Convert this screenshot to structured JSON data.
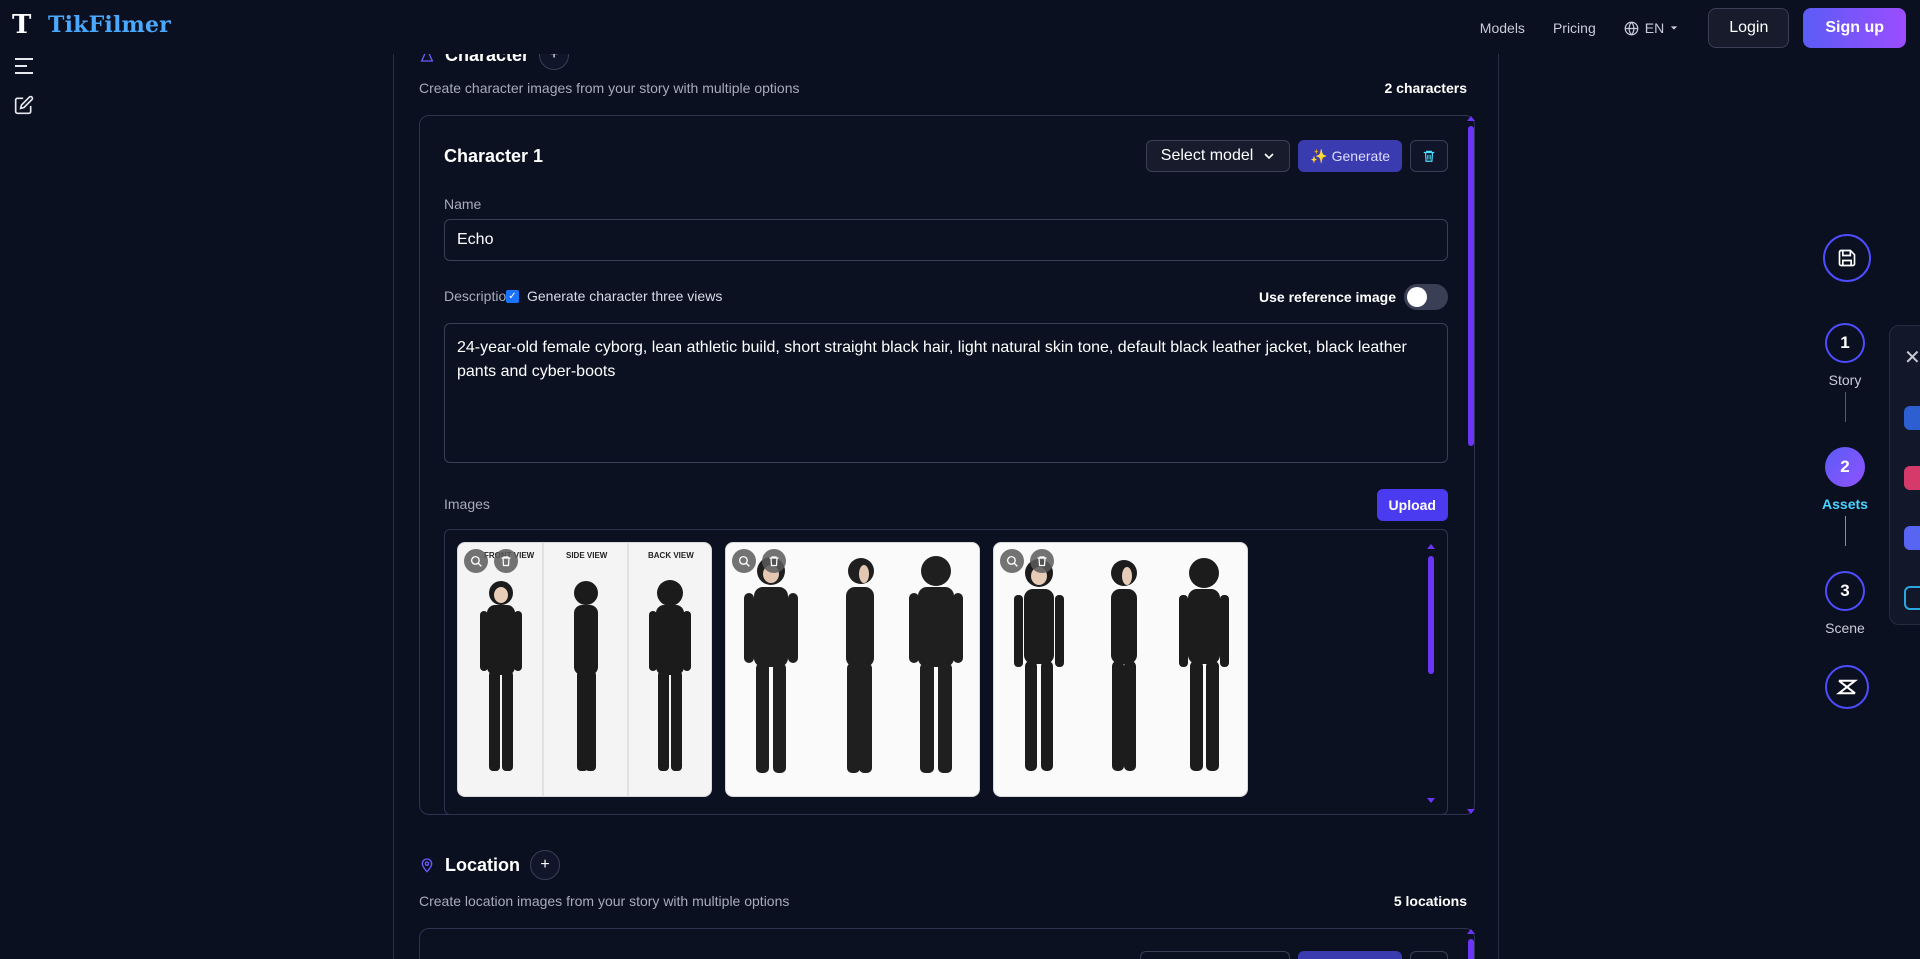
{
  "brand": {
    "logo_mark": "T",
    "name": "TikFilmer"
  },
  "nav": {
    "models": "Models",
    "pricing": "Pricing",
    "language": "EN",
    "login": "Login",
    "signup": "Sign up"
  },
  "character_section": {
    "title": "Character",
    "subtitle": "Create character images from your story with multiple options",
    "count": "2 characters",
    "card": {
      "title": "Character 1",
      "select_model": "Select model",
      "generate": "✨ Generate",
      "name_label": "Name",
      "name_value": "Echo",
      "description_label": "Description",
      "three_views_label": "Generate character three views",
      "three_views_checked": true,
      "use_reference_label": "Use reference image",
      "use_reference_on": false,
      "description_value": "24-year-old female cyborg, lean athletic build, short straight black hair, light natural skin tone, default black leather jacket, black leather pants and cyber-boots",
      "images_label": "Images",
      "upload": "Upload",
      "images": [
        {
          "labels": [
            "FRONT VIEW",
            "SIDE VIEW",
            "BACK VIEW"
          ]
        },
        {
          "labels": []
        },
        {
          "labels": []
        }
      ]
    }
  },
  "location_section": {
    "title": "Location",
    "subtitle": "Create location images from your story with multiple options",
    "count": "5 locations"
  },
  "stepper": {
    "steps": [
      {
        "number": "1",
        "label": "Story"
      },
      {
        "number": "2",
        "label": "Assets"
      },
      {
        "number": "3",
        "label": "Scene"
      }
    ],
    "active_step": 2
  },
  "colors": {
    "background": "#0b1020",
    "accent": "#5b5cf6",
    "accent_cyan": "#4ad3ff"
  }
}
